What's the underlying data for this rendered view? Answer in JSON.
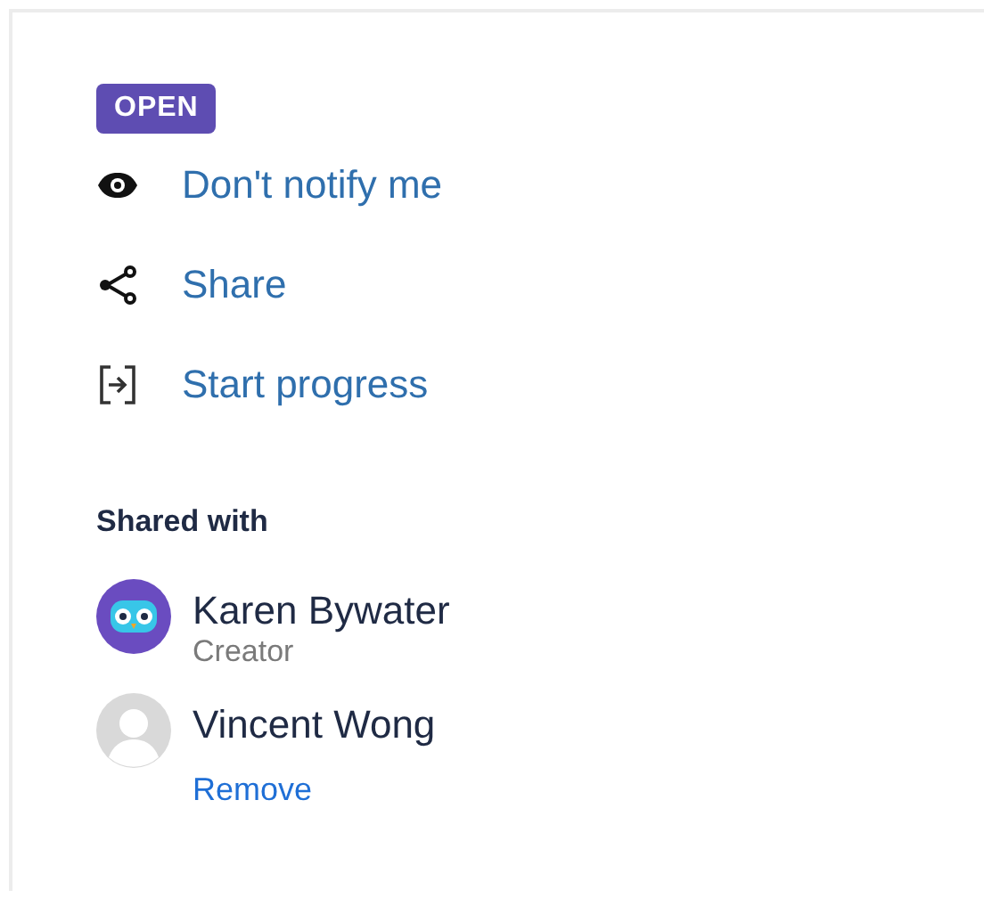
{
  "status_badge": "OPEN",
  "actions": [
    {
      "kind": "watch",
      "label": "Don't notify me"
    },
    {
      "kind": "share",
      "label": "Share"
    },
    {
      "kind": "progress",
      "label": "Start progress"
    }
  ],
  "shared_with": {
    "heading": "Shared with",
    "people": [
      {
        "kind": "owl",
        "name": "Karen Bywater",
        "role": "Creator"
      },
      {
        "kind": "default",
        "name": "Vincent Wong",
        "link": "Remove"
      }
    ]
  }
}
